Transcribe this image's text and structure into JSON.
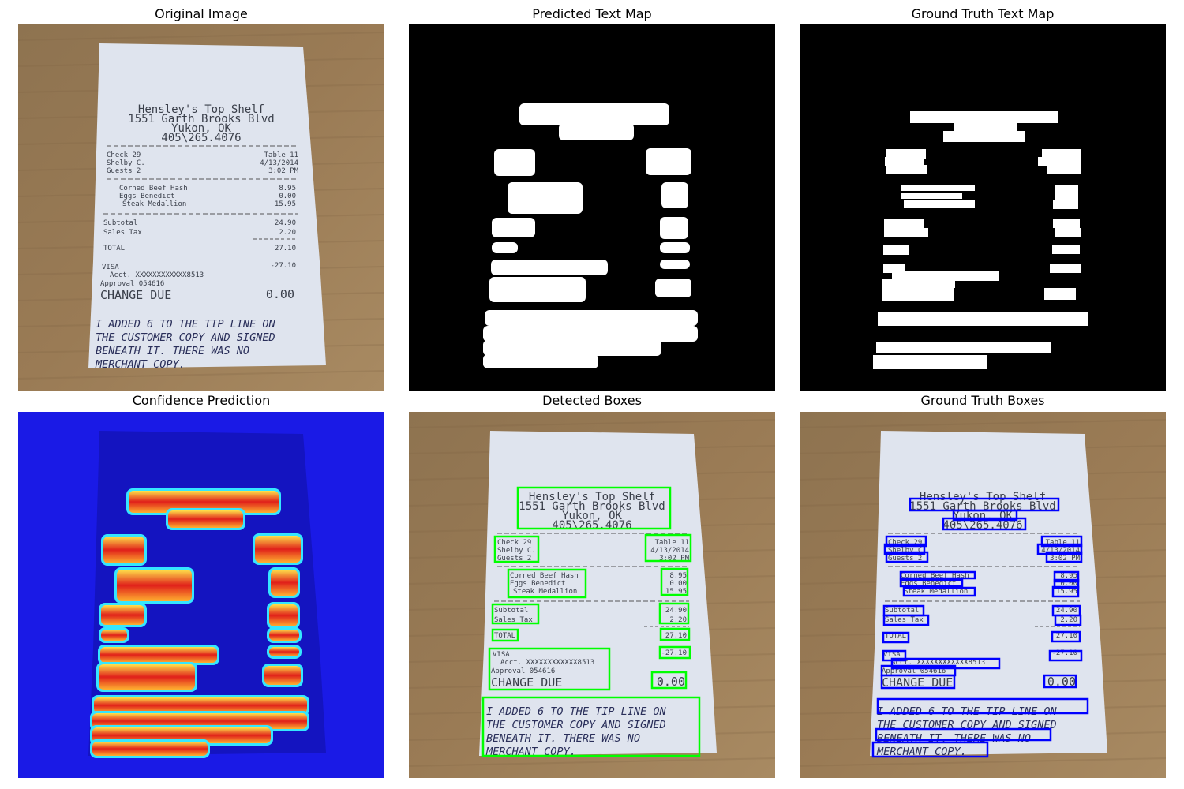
{
  "titles": {
    "original": "Original Image",
    "predicted_map": "Predicted Text Map",
    "gt_map": "Ground Truth Text Map",
    "confidence": "Confidence Prediction",
    "detected": "Detected Boxes",
    "gt_boxes": "Ground Truth Boxes"
  },
  "receipt": {
    "name": "Hensley's Top Shelf",
    "address": "1551 Garth Brooks Blvd",
    "city": "Yukon, OK",
    "phone": "405\\265.4076",
    "check": "Check 29",
    "server": "Shelby C.",
    "guests": "Guests 2",
    "table": "Table 11",
    "date": "4/13/2014",
    "time": "3:02 PM",
    "items": [
      {
        "name": "Corned Beef Hash",
        "price": "8.95"
      },
      {
        "name": "Eggs Benedict",
        "price": "0.00"
      },
      {
        "name": "Steak Medallion",
        "price": "15.95"
      }
    ],
    "subtotal_label": "Subtotal",
    "subtotal": "24.90",
    "tax_label": "Sales Tax",
    "tax": "2.20",
    "total_label": "TOTAL",
    "total": "27.10",
    "payment": "VISA",
    "payment_amount": "-27.10",
    "acct": "Acct. XXXXXXXXXXXX8513",
    "approval": "Approval 054616",
    "change_label": "CHANGE DUE",
    "change": "0.00",
    "handwriting": [
      "I ADDED 6 TO THE TIP LINE ON",
      "THE CUSTOMER COPY AND SIGNED",
      "BENEATH IT. THERE WAS NO",
      "MERCHANT COPY."
    ]
  },
  "colors": {
    "wood": "#9a7b55",
    "paper": "#dfe4ee",
    "detected_box": "#00ff00",
    "gt_box": "#0000ff",
    "map_bg": "#000000",
    "map_fg": "#ffffff",
    "heat_bg": "#1a1ae6"
  }
}
